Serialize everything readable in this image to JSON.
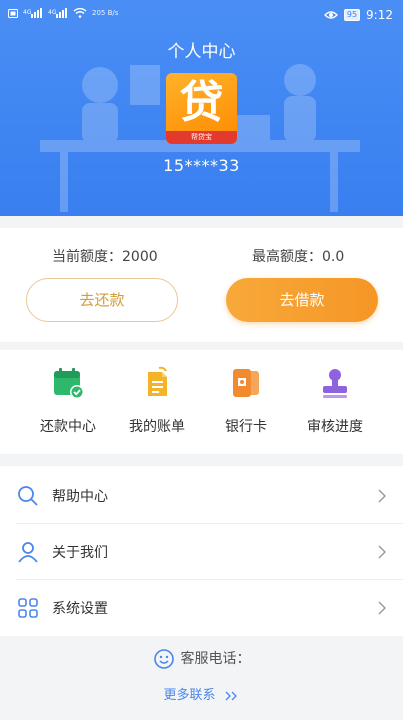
{
  "status_bar": {
    "speed": "205 B/s",
    "battery": "95",
    "time": "9:12"
  },
  "header": {
    "title": "个人中心",
    "logo_glyph": "贷",
    "logo_brand": "帮贷宝",
    "phone": "15****33"
  },
  "quota": {
    "current_label": "当前额度：2000",
    "max_label": "最高额度：0.0",
    "repay_button": "去还款",
    "borrow_button": "去借款"
  },
  "shortcuts": [
    {
      "label": "还款中心",
      "icon": "calendar-check-icon",
      "color": "#2eb86b"
    },
    {
      "label": "我的账单",
      "icon": "bill-icon",
      "color": "#f5b428"
    },
    {
      "label": "银行卡",
      "icon": "bank-card-icon",
      "color": "#f28a2e"
    },
    {
      "label": "审核进度",
      "icon": "stamp-icon",
      "color": "#8f63e0"
    }
  ],
  "menu": [
    {
      "label": "帮助中心",
      "icon": "search-icon"
    },
    {
      "label": "关于我们",
      "icon": "user-icon"
    },
    {
      "label": "系统设置",
      "icon": "settings-grid-icon"
    }
  ],
  "service": {
    "phone_label": "客服电话：",
    "more_link": "更多联系"
  },
  "colors": {
    "header_blue": "#3f85f2",
    "accent_orange": "#f59626",
    "outline_gold": "#d39c3c",
    "link_blue": "#4a86ef"
  }
}
